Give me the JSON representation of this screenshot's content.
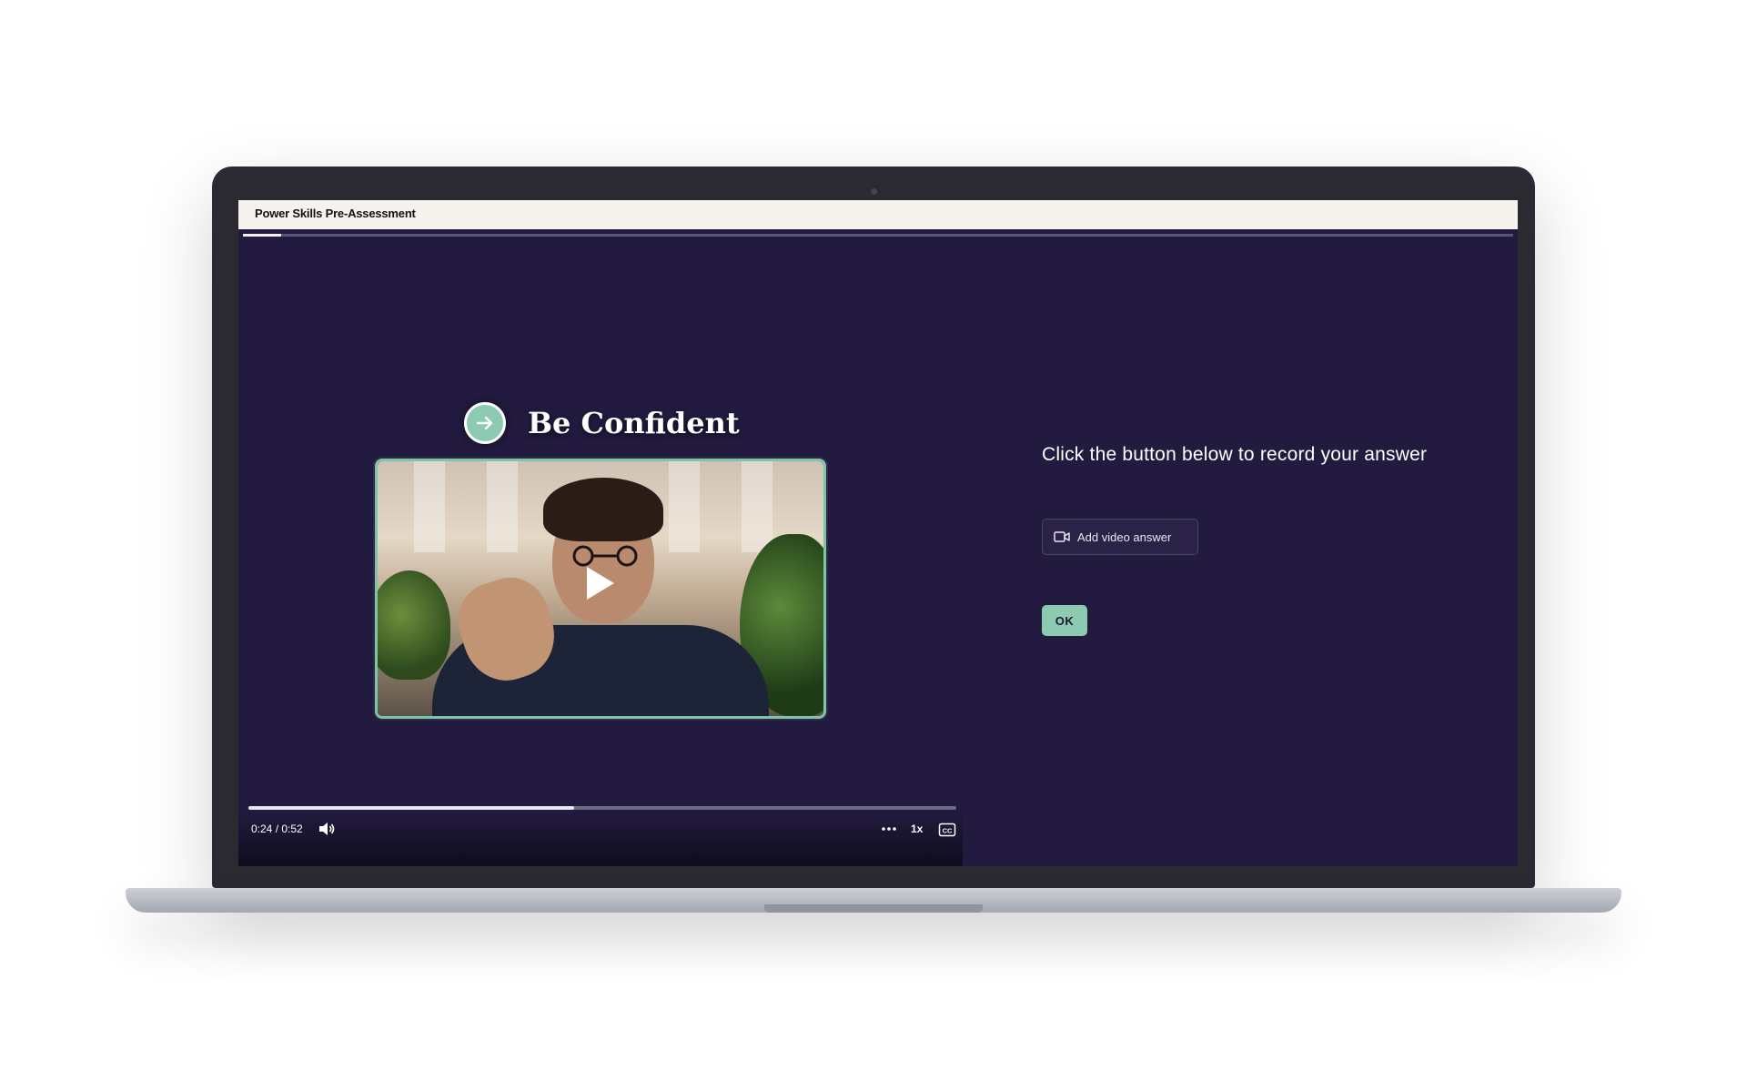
{
  "app": {
    "title": "Power Skills Pre-Assessment"
  },
  "assessment_progress": 0.03,
  "video": {
    "heading": "Be Confident",
    "heading_icon": "arrow-right-circle-icon",
    "time": "0:24 / 0:52",
    "progress": 0.46,
    "speed": "1x",
    "play_icon": "play-icon",
    "volume_icon": "volume-icon",
    "more_icon": "more-horizontal-icon",
    "captions_icon": "closed-captions-icon"
  },
  "answer": {
    "prompt": "Click the button below to record your answer",
    "add_video_label": "Add video answer",
    "add_video_icon": "video-camera-icon",
    "ok_label": "OK"
  },
  "colors": {
    "background": "#221a3f",
    "accent": "#8ccbb2",
    "header": "#f6f3ef"
  }
}
